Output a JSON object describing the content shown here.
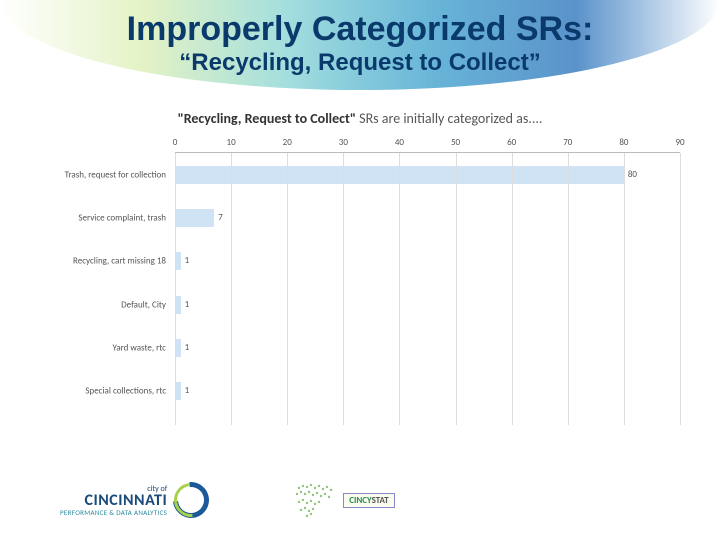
{
  "header": {
    "title": "Improperly Categorized SRs:",
    "subtitle": "“Recycling, Request to Collect”"
  },
  "chart_data": {
    "type": "bar",
    "orientation": "horizontal",
    "title_prefix": "\"Recycling, Request to Collect\"",
    "title_suffix": " SRs are initially categorized as....",
    "categories": [
      "Trash, request for collection",
      "Service complaint, trash",
      "Recycling, cart missing 18",
      "Default, City",
      "Yard waste, rtc",
      "Special collections, rtc"
    ],
    "values": [
      80,
      7,
      1,
      1,
      1,
      1
    ],
    "xlim": [
      0,
      90
    ],
    "xticks": [
      0,
      10,
      20,
      30,
      40,
      50,
      60,
      70,
      80,
      90
    ],
    "bar_color": "#cfe3f5"
  },
  "footer": {
    "cincinnati": {
      "top": "city of",
      "main": "CINCINNATI",
      "sub": "PERFORMANCE & DATA ANALYTICS"
    },
    "cincystat": {
      "label": "CINCYSTAT"
    }
  }
}
